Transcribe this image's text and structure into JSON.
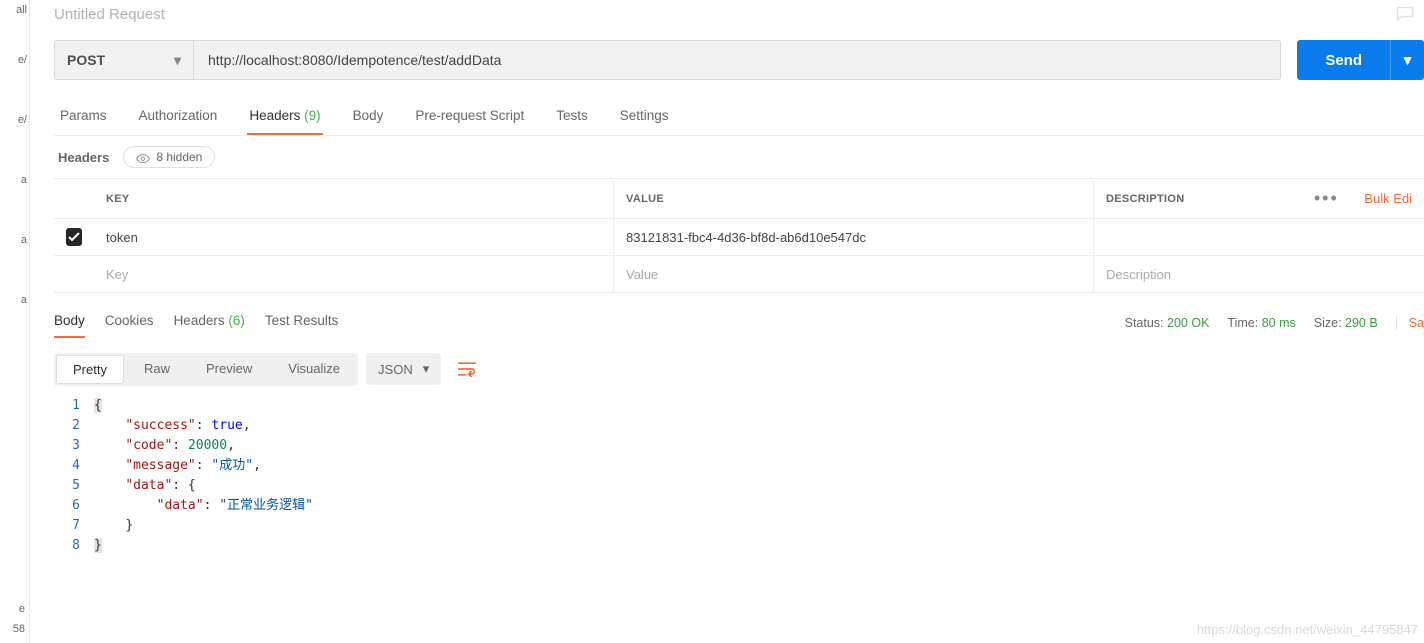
{
  "title": "Untitled Request",
  "sidebar": {
    "items": [
      "all",
      "e/",
      "e/",
      "a",
      "a",
      "a"
    ],
    "bottom": [
      "e",
      "58"
    ]
  },
  "request": {
    "method": "POST",
    "url": "http://localhost:8080/Idempotence/test/addData",
    "send_label": "Send"
  },
  "req_tabs": {
    "params": "Params",
    "auth": "Authorization",
    "headers": "Headers",
    "headers_count": "(9)",
    "body": "Body",
    "prerequest": "Pre-request Script",
    "tests": "Tests",
    "settings": "Settings"
  },
  "headers_section": {
    "label": "Headers",
    "hidden_label": "8 hidden",
    "cols": {
      "key": "KEY",
      "value": "VALUE",
      "desc": "DESCRIPTION"
    },
    "bulk": "Bulk Edi",
    "rows": [
      {
        "checked": true,
        "key": "token",
        "value": "83121831-fbc4-4d36-bf8d-ab6d10e547dc",
        "desc": ""
      }
    ],
    "placeholders": {
      "key": "Key",
      "value": "Value",
      "desc": "Description"
    }
  },
  "resp_tabs": {
    "body": "Body",
    "cookies": "Cookies",
    "headers": "Headers",
    "headers_count": "(6)",
    "tests": "Test Results"
  },
  "resp_meta": {
    "status_label": "Status:",
    "status_value": "200 OK",
    "time_label": "Time:",
    "time_value": "80 ms",
    "size_label": "Size:",
    "size_value": "290 B",
    "save": "Sa"
  },
  "viewer": {
    "pretty": "Pretty",
    "raw": "Raw",
    "preview": "Preview",
    "visualize": "Visualize",
    "format": "JSON"
  },
  "response_json": {
    "success": true,
    "code": 20000,
    "message": "成功",
    "data": {
      "data": "正常业务逻辑"
    }
  },
  "watermark": "https://blog.csdn.net/weixin_44795847"
}
